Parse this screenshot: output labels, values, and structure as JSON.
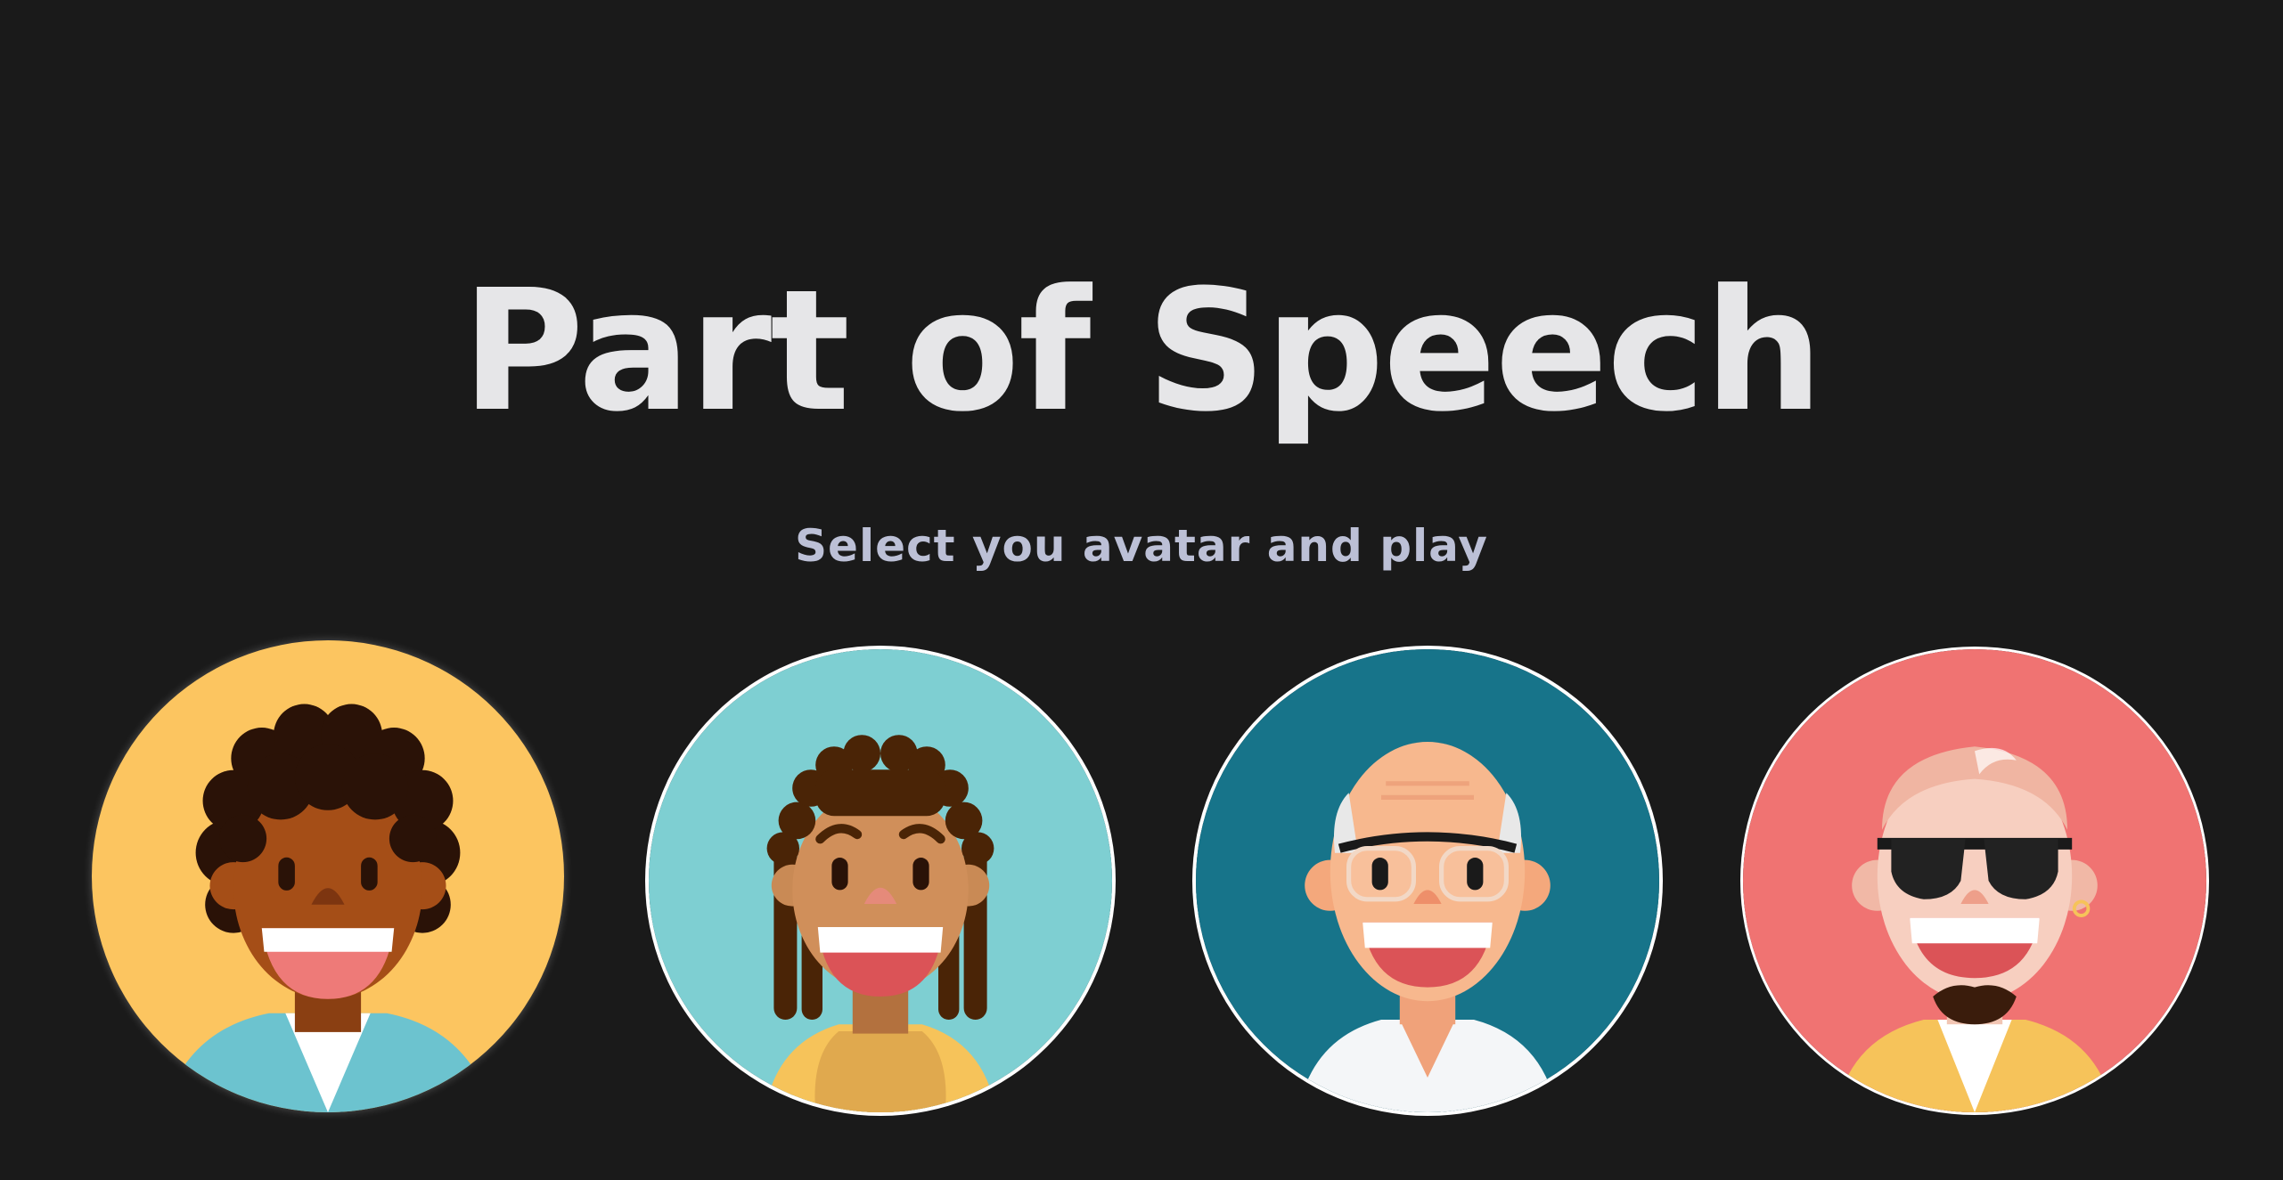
{
  "title": "Part of Speech",
  "subtitle": "Select you avatar and play",
  "colors": {
    "background": "#1a1a1a",
    "title": "#e6e6e8",
    "subtitle": "#bcc0d6",
    "avatar_1_bg": "#fcc560",
    "avatar_2_bg": "#7ecfd2",
    "avatar_3_bg": "#17748a",
    "avatar_4_bg": "#f07372"
  },
  "avatars": [
    {
      "icon": "curly-hair-boy-avatar-icon"
    },
    {
      "icon": "braided-hair-girl-avatar-icon"
    },
    {
      "icon": "bald-man-with-glasses-avatar-icon"
    },
    {
      "icon": "man-with-sunglasses-and-beard-avatar-icon"
    }
  ]
}
